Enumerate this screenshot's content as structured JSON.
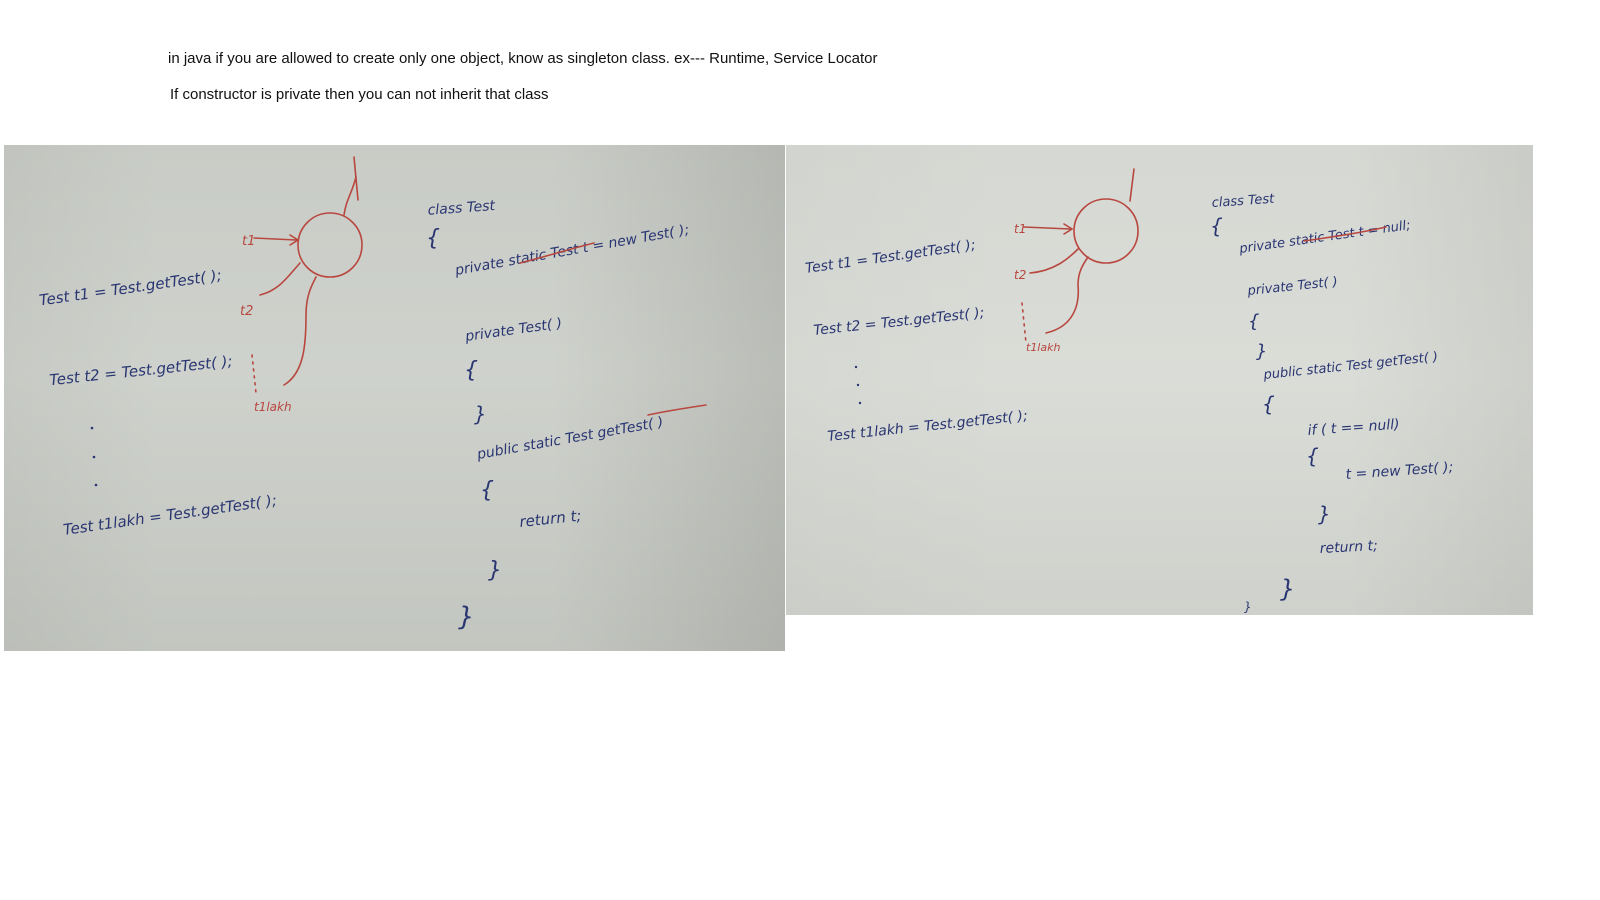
{
  "notes": {
    "line1": "in java if you are allowed to create only one object, know as singleton class. ex--- Runtime, Service Locator",
    "line2": "If constructor is private then you can not inherit that class"
  },
  "whiteboard_left": {
    "caller_lines": [
      "Test   t1 = Test.getTest( );",
      "Test   t2 = Test.getTest( );",
      "Test   t1lakh = Test.getTest( );"
    ],
    "ref_labels": [
      "t1",
      "t2",
      "t1lakh"
    ],
    "code_lines": [
      "class  Test",
      "{",
      "private  static   Test  t = new  Test( );",
      "private  Test( )",
      "{",
      "}",
      "public  static   Test   getTest( )",
      "{",
      "return  t;",
      "}",
      "}"
    ]
  },
  "whiteboard_right": {
    "caller_lines": [
      "Test   t1 = Test.getTest( );",
      "Test   t2 = Test.getTest( );",
      "Test   t1lakh = Test.getTest( );"
    ],
    "ref_labels": [
      "t1",
      "t2",
      "t1lakh"
    ],
    "code_lines": [
      "class  Test",
      "{",
      "private  static   Test  t = null;",
      "private  Test( )",
      "{",
      "}",
      "public  static   Test   getTest( )",
      "{",
      "if ( t == null)",
      "{",
      "t = new  Test( );",
      "}",
      "return  t;",
      "}",
      "}"
    ]
  },
  "colors": {
    "marker_blue": "#2a3672",
    "marker_red": "#b8473f"
  }
}
